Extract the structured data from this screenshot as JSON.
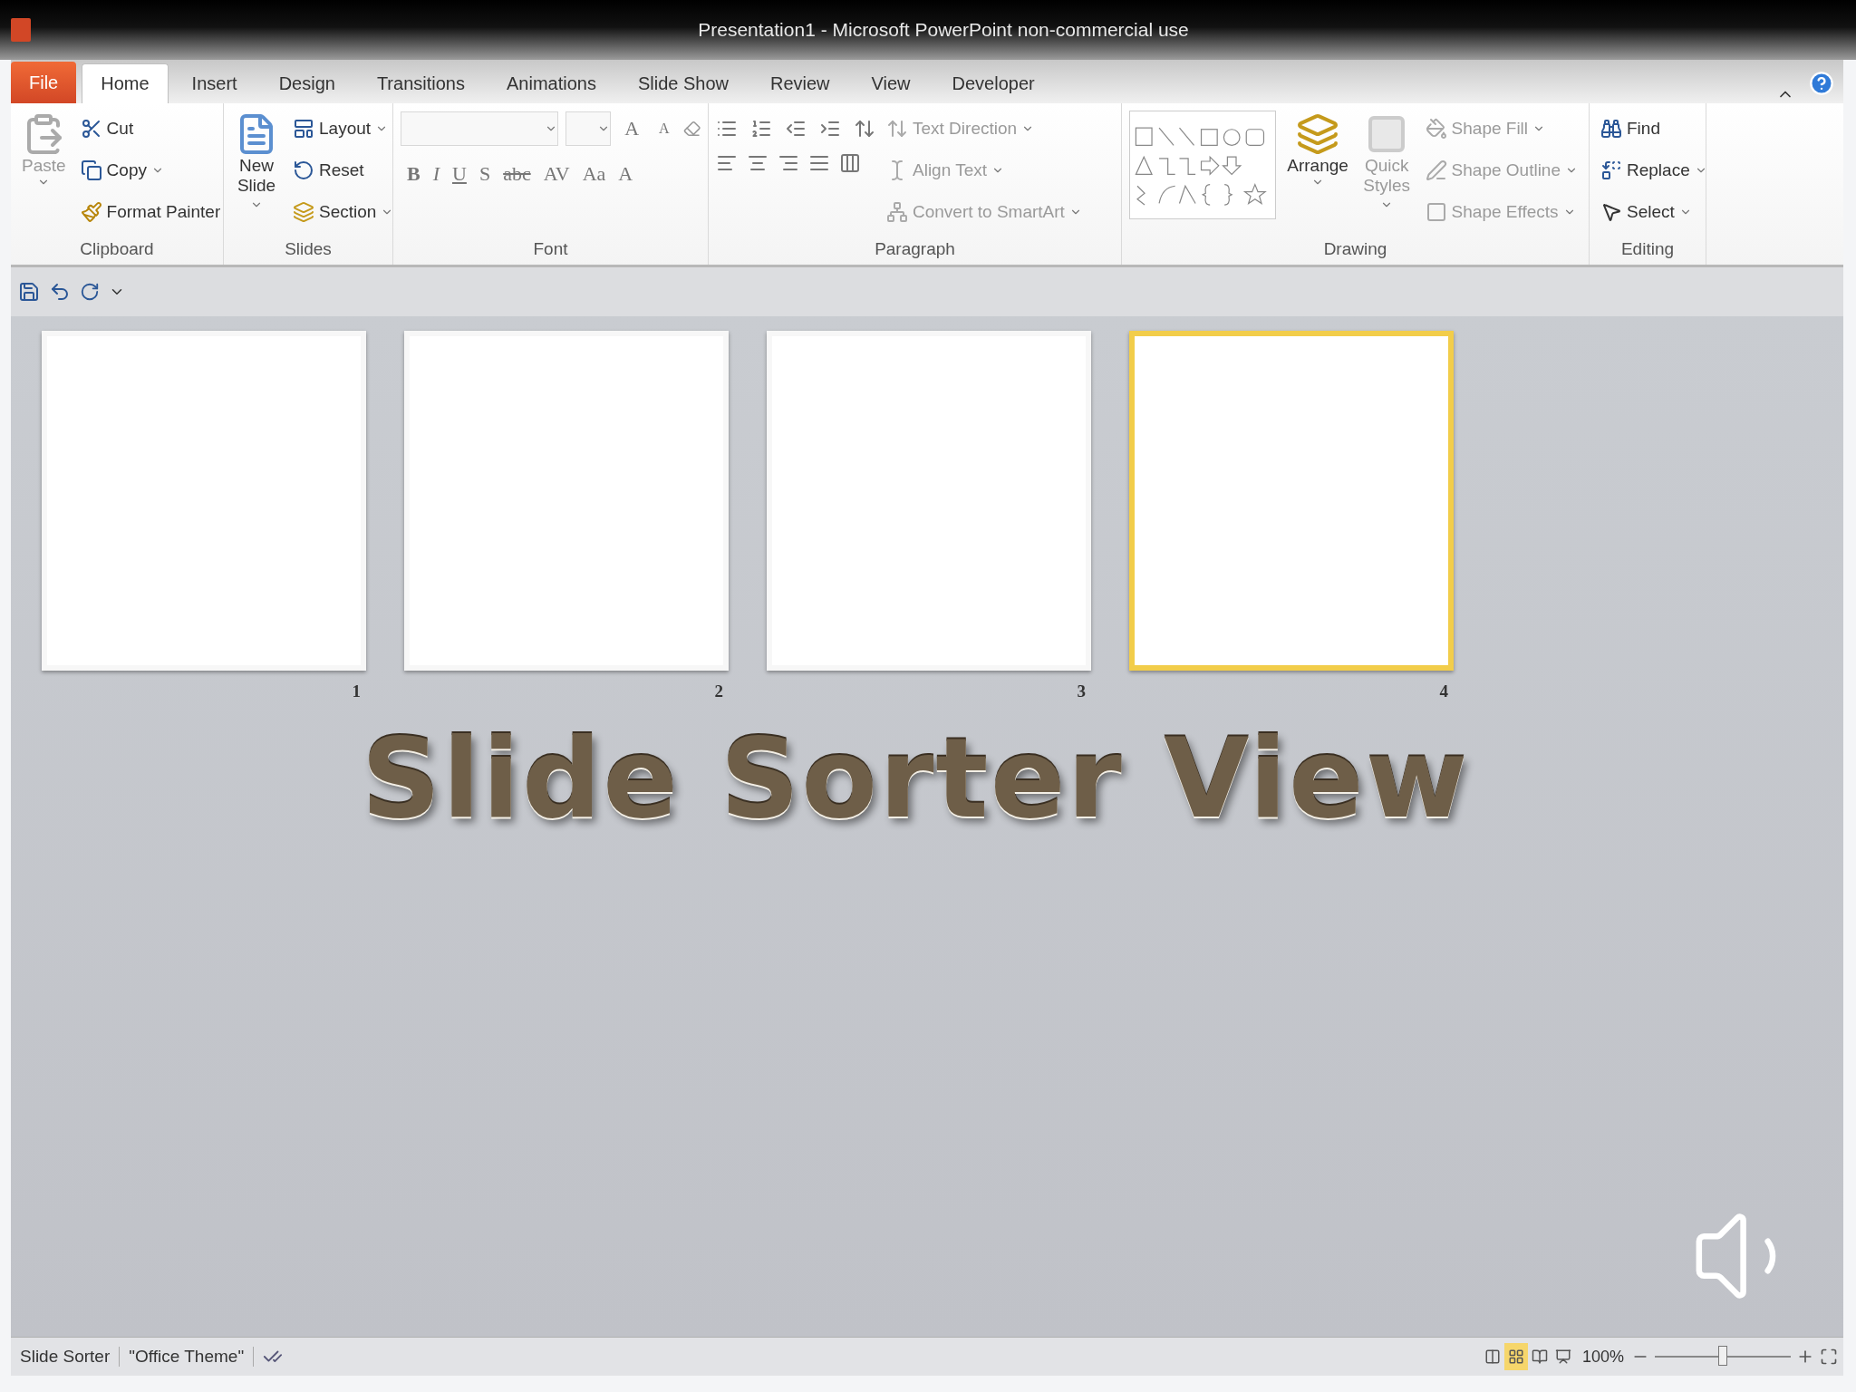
{
  "window": {
    "title": "Presentation1  -  Microsoft PowerPoint non-commercial use"
  },
  "tabs": [
    {
      "label": "File",
      "kind": "file",
      "selected": false
    },
    {
      "label": "Home",
      "kind": "tab",
      "selected": true
    },
    {
      "label": "Insert",
      "kind": "tab",
      "selected": false
    },
    {
      "label": "Design",
      "kind": "tab",
      "selected": false
    },
    {
      "label": "Transitions",
      "kind": "tab",
      "selected": false
    },
    {
      "label": "Animations",
      "kind": "tab",
      "selected": false
    },
    {
      "label": "Slide Show",
      "kind": "tab",
      "selected": false
    },
    {
      "label": "Review",
      "kind": "tab",
      "selected": false
    },
    {
      "label": "View",
      "kind": "tab",
      "selected": false
    },
    {
      "label": "Developer",
      "kind": "tab",
      "selected": false
    }
  ],
  "ribbon": {
    "clipboard": {
      "label": "Clipboard",
      "paste": {
        "label": "Paste",
        "disabled": true
      },
      "items": [
        {
          "label": "Cut",
          "kind": "cut",
          "dropdown": false
        },
        {
          "label": "Copy",
          "kind": "copy",
          "dropdown": true
        },
        {
          "label": "Format Painter",
          "kind": "painter",
          "dropdown": false
        }
      ]
    },
    "slides": {
      "label": "Slides",
      "new_slide": {
        "line1": "New",
        "line2": "Slide"
      },
      "items": [
        {
          "label": "Layout",
          "kind": "layout",
          "dropdown": true
        },
        {
          "label": "Reset",
          "kind": "reset",
          "dropdown": false
        },
        {
          "label": "Section",
          "kind": "section",
          "dropdown": true
        }
      ]
    },
    "font": {
      "label": "Font",
      "grow": "A",
      "shrink": "A",
      "buttons": [
        {
          "text": "B",
          "kind": "bold"
        },
        {
          "text": "I",
          "kind": "italic"
        },
        {
          "text": "U",
          "kind": "underline"
        },
        {
          "text": "S",
          "kind": "shadow"
        },
        {
          "text": "abc",
          "kind": "strike"
        },
        {
          "text": "AV",
          "kind": "spacing"
        },
        {
          "text": "Aa",
          "kind": "case"
        },
        {
          "text": "A",
          "kind": "color"
        }
      ]
    },
    "paragraph": {
      "label": "Paragraph",
      "items": [
        {
          "label": "Text Direction",
          "kind": "direction",
          "disabled": true
        },
        {
          "label": "Align Text",
          "kind": "align",
          "disabled": true
        },
        {
          "label": "Convert to SmartArt",
          "kind": "smartart",
          "disabled": true
        }
      ]
    },
    "drawing": {
      "label": "Drawing",
      "arrange": "Arrange",
      "quick_styles": {
        "line1": "Quick",
        "line2": "Styles",
        "disabled": true
      },
      "items": [
        {
          "label": "Shape Fill",
          "kind": "fill",
          "disabled": true
        },
        {
          "label": "Shape Outline",
          "kind": "outline",
          "disabled": true
        },
        {
          "label": "Shape Effects",
          "kind": "effects",
          "disabled": true
        }
      ]
    },
    "editing": {
      "label": "Editing",
      "items": [
        {
          "label": "Find",
          "kind": "find",
          "dropdown": false
        },
        {
          "label": "Replace",
          "kind": "replace",
          "dropdown": true
        },
        {
          "label": "Select",
          "kind": "select",
          "dropdown": true
        }
      ]
    }
  },
  "slides": [
    {
      "number": "1",
      "selected": false
    },
    {
      "number": "2",
      "selected": false
    },
    {
      "number": "3",
      "selected": false
    },
    {
      "number": "4",
      "selected": true
    }
  ],
  "overlay_caption": "Slide Sorter View",
  "status_bar": {
    "view": "Slide Sorter",
    "theme": "\"Office Theme\"",
    "views": [
      {
        "kind": "normal",
        "selected": false
      },
      {
        "kind": "sorter",
        "selected": true
      },
      {
        "kind": "reading",
        "selected": false
      },
      {
        "kind": "show",
        "selected": false
      }
    ],
    "zoom": "100%",
    "zoom_slider": {
      "level": 0.5
    }
  }
}
